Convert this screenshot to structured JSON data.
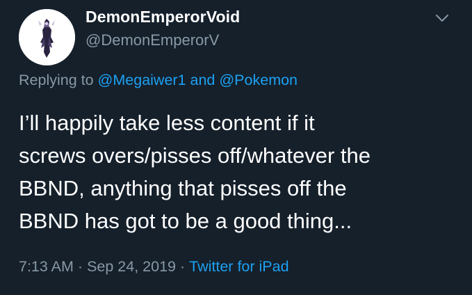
{
  "user": {
    "display_name": "DemonEmperorVoid",
    "handle": "@DemonEmperorV"
  },
  "reply": {
    "prefix": "Replying to ",
    "mention_1": "@Megaiwer1",
    "conjunction": " and ",
    "mention_2": "@Pokemon"
  },
  "tweet": {
    "lines": [
      "I’ll happily take less content if it",
      "screws overs/pisses off/whatever the",
      "BBND, anything that pisses off the",
      "BBND has got to be a good thing..."
    ]
  },
  "meta": {
    "time": "7:13 AM",
    "separator": "·",
    "date": "Sep 24, 2019",
    "source": "Twitter for iPad"
  },
  "colors": {
    "background": "#15202b",
    "text": "#ffffff",
    "secondary": "#8899a6",
    "link": "#1da1f2"
  },
  "icons": {
    "caret": "chevron-down-icon"
  }
}
